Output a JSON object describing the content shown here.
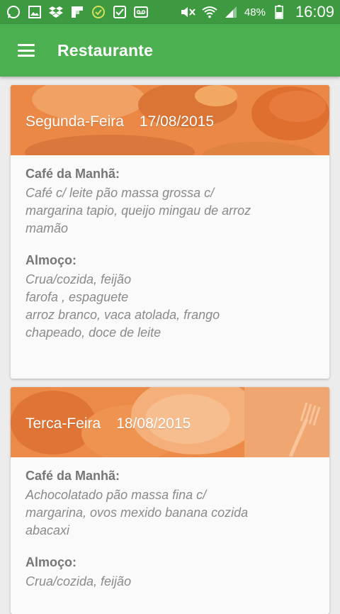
{
  "status_bar": {
    "battery": "48%",
    "time": "16:09"
  },
  "app_bar": {
    "title": "Restaurante"
  },
  "cards": [
    {
      "day": "Segunda-Feira",
      "date": "17/08/2015",
      "meals": [
        {
          "title": "Café da Manhã:",
          "text": "Café c/ leite pão massa grossa  c/\nmargarina tapio, queijo mingau de arroz\nmamão"
        },
        {
          "title": "Almoço:",
          "text": "Crua/cozida, feijão\nfarofa                                , espaguete\narroz branco, vaca atolada, frango\nchapeado, doce de leite"
        }
      ]
    },
    {
      "day": "Terca-Feira",
      "date": "18/08/2015",
      "meals": [
        {
          "title": "Café da Manhã:",
          "text": "Achocolatado pão massa fina  c/\nmargarina, ovos mexido banana cozida\nabacaxi"
        },
        {
          "title": "Almoço:",
          "text": "Crua/cozida, feijão"
        }
      ]
    }
  ],
  "colors": {
    "status_bar": "#3e9a41",
    "app_bar": "#4caf50",
    "header_overlay": "#ef8a43"
  }
}
